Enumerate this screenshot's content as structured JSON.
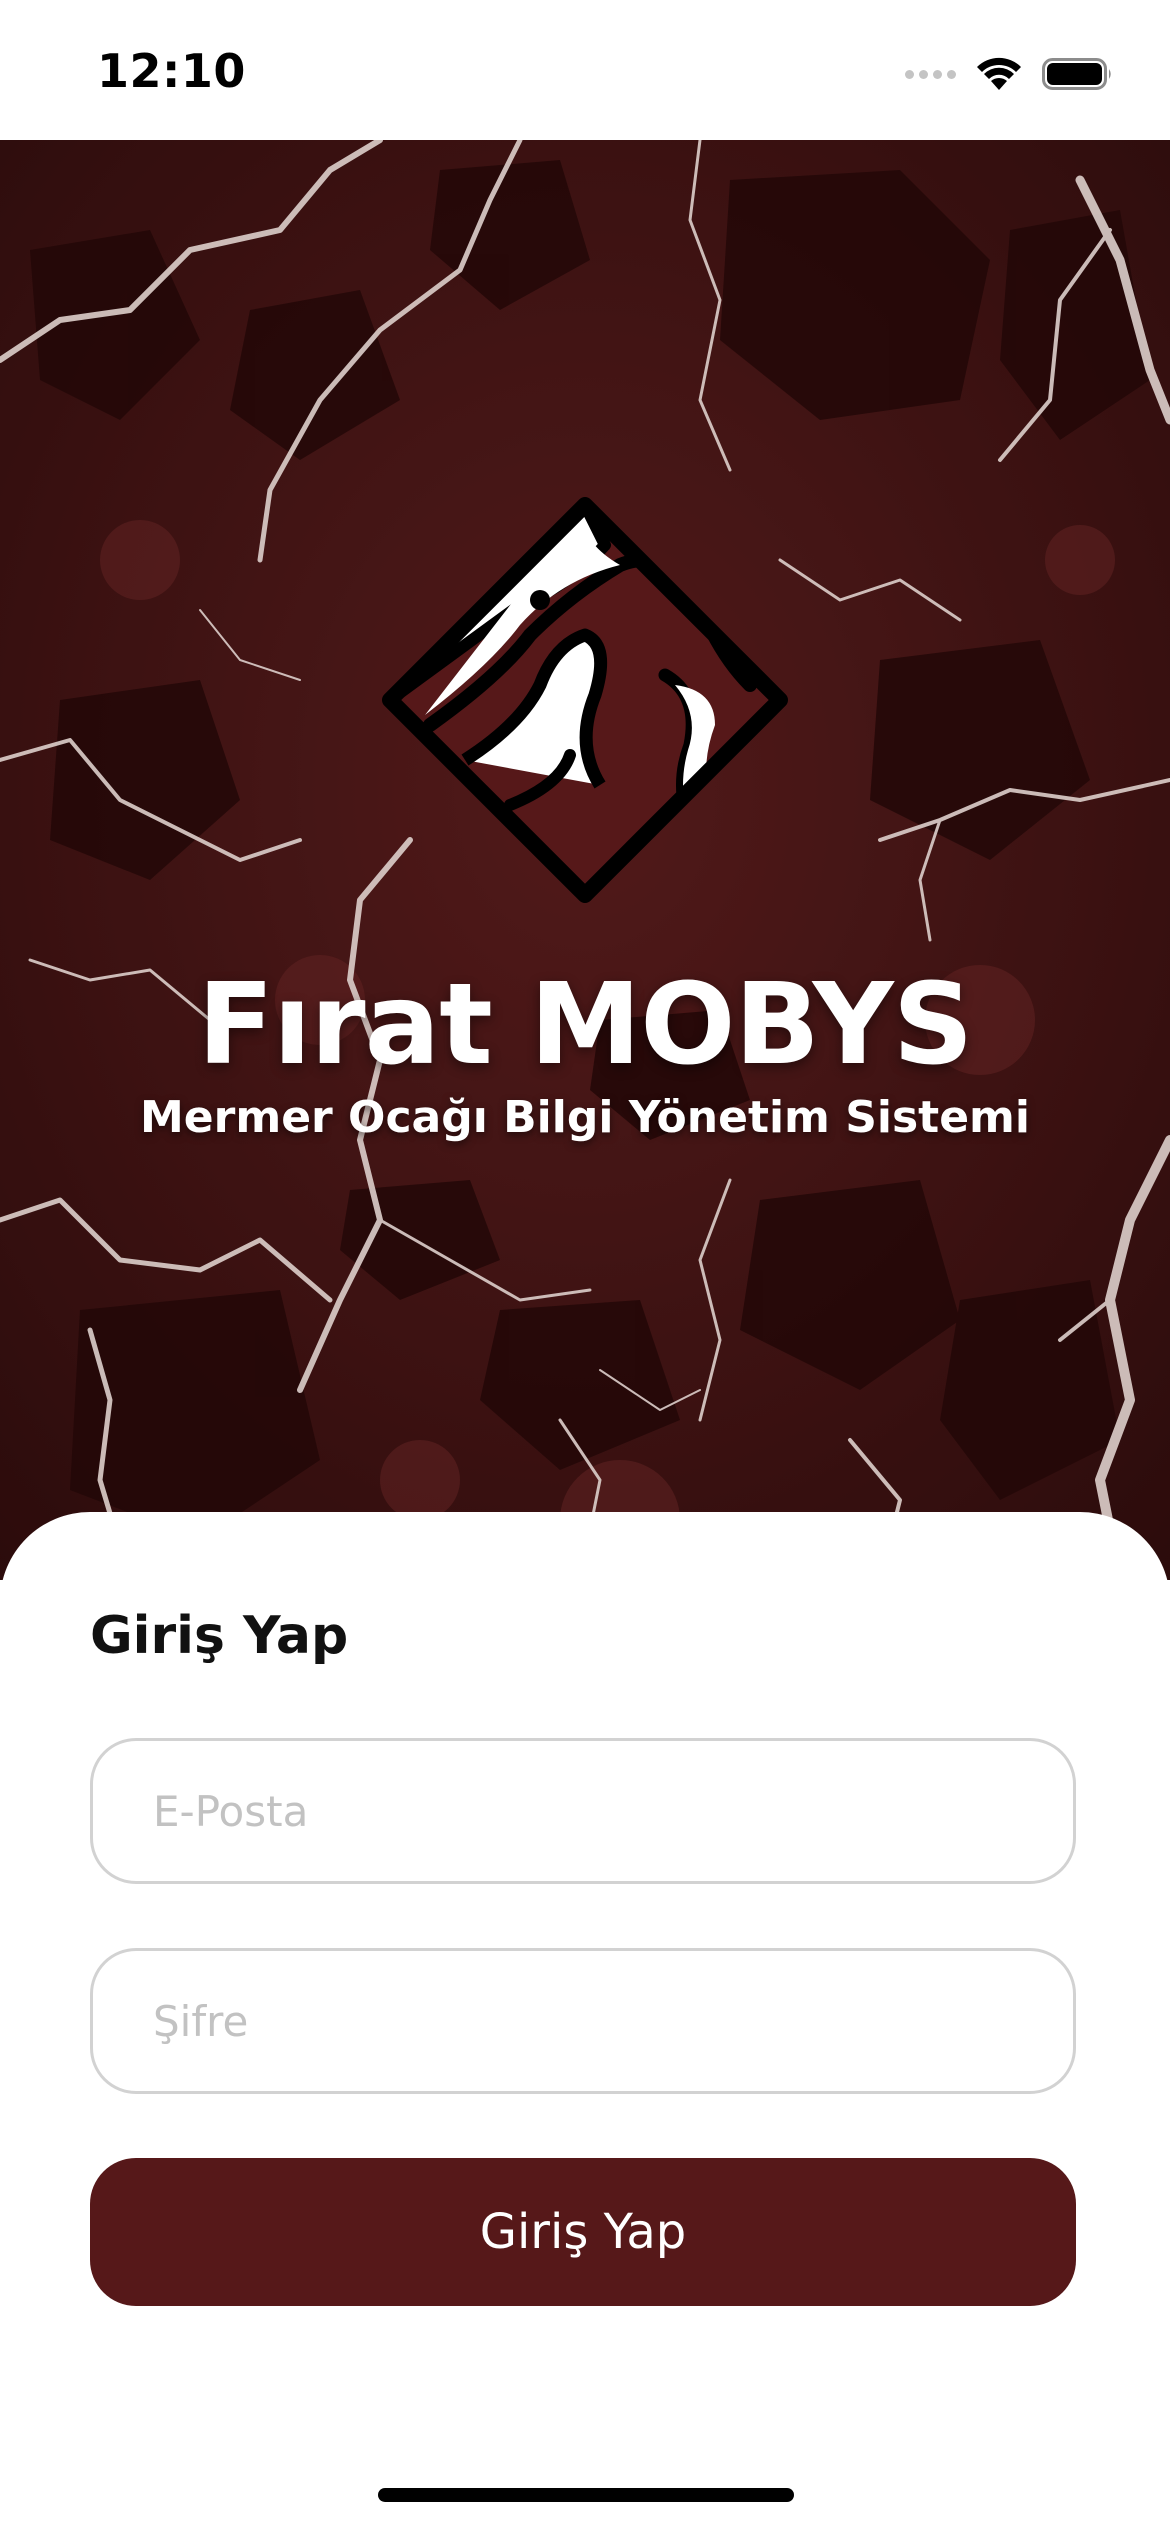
{
  "status_bar": {
    "time": "12:10",
    "icons": [
      "cellular-signal-icon",
      "wifi-icon",
      "battery-icon"
    ]
  },
  "hero": {
    "logo_icon": "marble-tile-logo-icon",
    "title": "Fırat MOBYS",
    "subtitle": "Mermer Ocağı Bilgi Yönetim Sistemi"
  },
  "login": {
    "heading": "Giriş Yap",
    "email_placeholder": "E-Posta",
    "email_value": "",
    "password_placeholder": "Şifre",
    "password_value": "",
    "submit_label": "Giriş Yap"
  },
  "colors": {
    "brand": "#561819",
    "marble_base": "#3d1212",
    "field_border": "#d2d2d2",
    "placeholder": "#c2c2c2"
  }
}
